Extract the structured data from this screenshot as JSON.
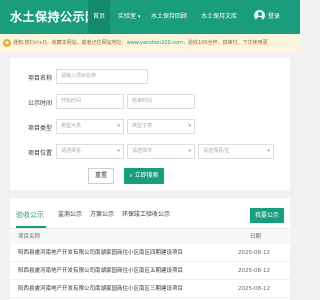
{
  "header": {
    "logo": "水土保持公示网",
    "nav": [
      {
        "label": "首页",
        "active": true
      },
      {
        "label": "实验室",
        "active": false,
        "dropdown": true
      },
      {
        "label": "水土保持回顾",
        "active": false
      },
      {
        "label": "水土保持文库",
        "active": false
      },
      {
        "label": "登录",
        "icon": "user-avatar-icon"
      }
    ]
  },
  "notice": {
    "text_before": "通知:按Ctrl+D，收藏本网站，或者记住网站地址：",
    "url": "www.yanshou100.com",
    "text_after": "，验收100全杯、搞审付、下次使用更"
  },
  "form": {
    "fields": [
      {
        "label": "项目名称",
        "placeholder": "请输入项目名称"
      },
      {
        "label": "公示时间",
        "start_placeholder": "开始时间",
        "end_placeholder": "结束时间"
      },
      {
        "label": "项目类型",
        "options": [
          "类型大类",
          "类型子类"
        ]
      },
      {
        "label": "项目位置",
        "options": [
          "请选择省",
          "请选择市",
          "请选择县/区"
        ]
      }
    ],
    "reset_label": "重置",
    "search_label": "立即搜索",
    "search_icon": "search-icon"
  },
  "results": {
    "tabs": [
      "验收公示",
      "监测公示",
      "方案公示",
      "环保竣工验收公示"
    ],
    "active_tab": 0,
    "subscribe_label": "我要公示",
    "columns": [
      "项目名称",
      "日期"
    ],
    "rows": [
      {
        "title": "阳西县虞河南地产开发有限公司南湖家园商住小区南区四期建设项目",
        "date": "2025-08-12"
      },
      {
        "title": "阳西县虞河南地产开发有限公司南湖家园商住小区南区五期建设项目",
        "date": "2025-08-12"
      },
      {
        "title": "阳西县虞河南地产开发有限公司南湖家园商住小区南区三期建设项目",
        "date": "2025-08-12"
      }
    ]
  },
  "colors": {
    "brand": "#1a9d7c",
    "notice_bg": "#fff5dc"
  }
}
